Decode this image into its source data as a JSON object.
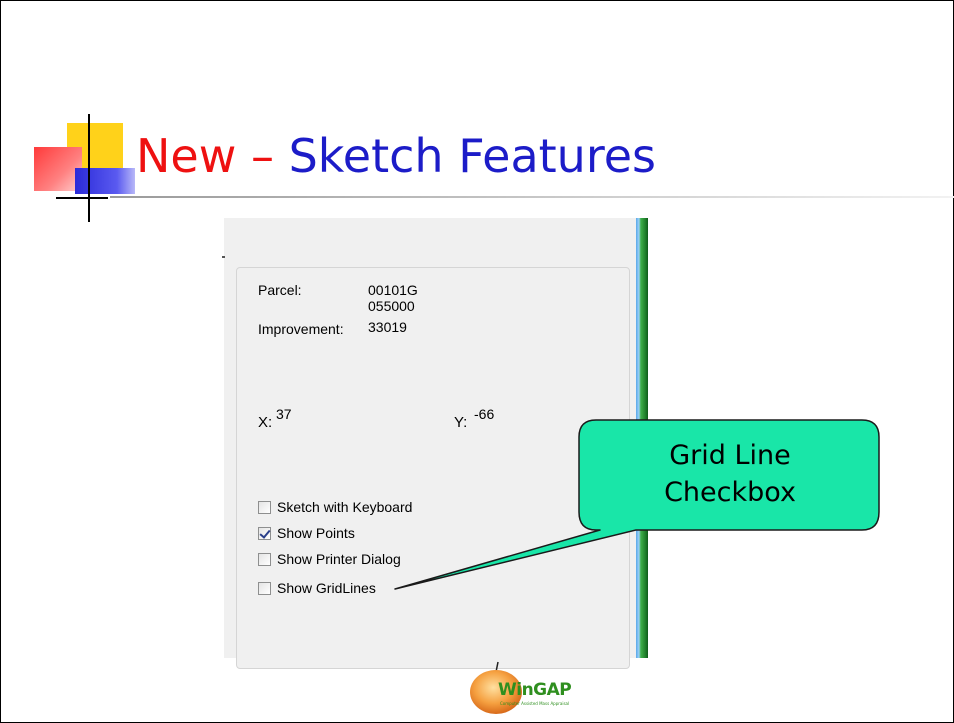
{
  "slide": {
    "title_part1": "New",
    "title_dash": " – ",
    "title_part2": "Sketch Features"
  },
  "panel": {
    "parcel_label": "Parcel:",
    "parcel_value_line1": "00101G",
    "parcel_value_line2": "055000",
    "improvement_label": "Improvement:",
    "improvement_value": "33019",
    "x_label": "X:",
    "x_value": "37",
    "y_label": "Y:",
    "y_value": "-66",
    "checkboxes": [
      {
        "label": "Sketch with Keyboard",
        "checked": false
      },
      {
        "label": "Show Points",
        "checked": true
      },
      {
        "label": "Show Printer Dialog",
        "checked": false
      },
      {
        "label": "Show GridLines",
        "checked": false
      }
    ]
  },
  "callout": {
    "line1": "Grid Line",
    "line2": "Checkbox",
    "fill_color": "#19e6a8"
  },
  "logo": {
    "name": "WinGAP",
    "tagline": "Computer Assisted Mass Appraisal"
  },
  "colors": {
    "title_red": "#ee1111",
    "title_blue": "#1c1cc8"
  }
}
